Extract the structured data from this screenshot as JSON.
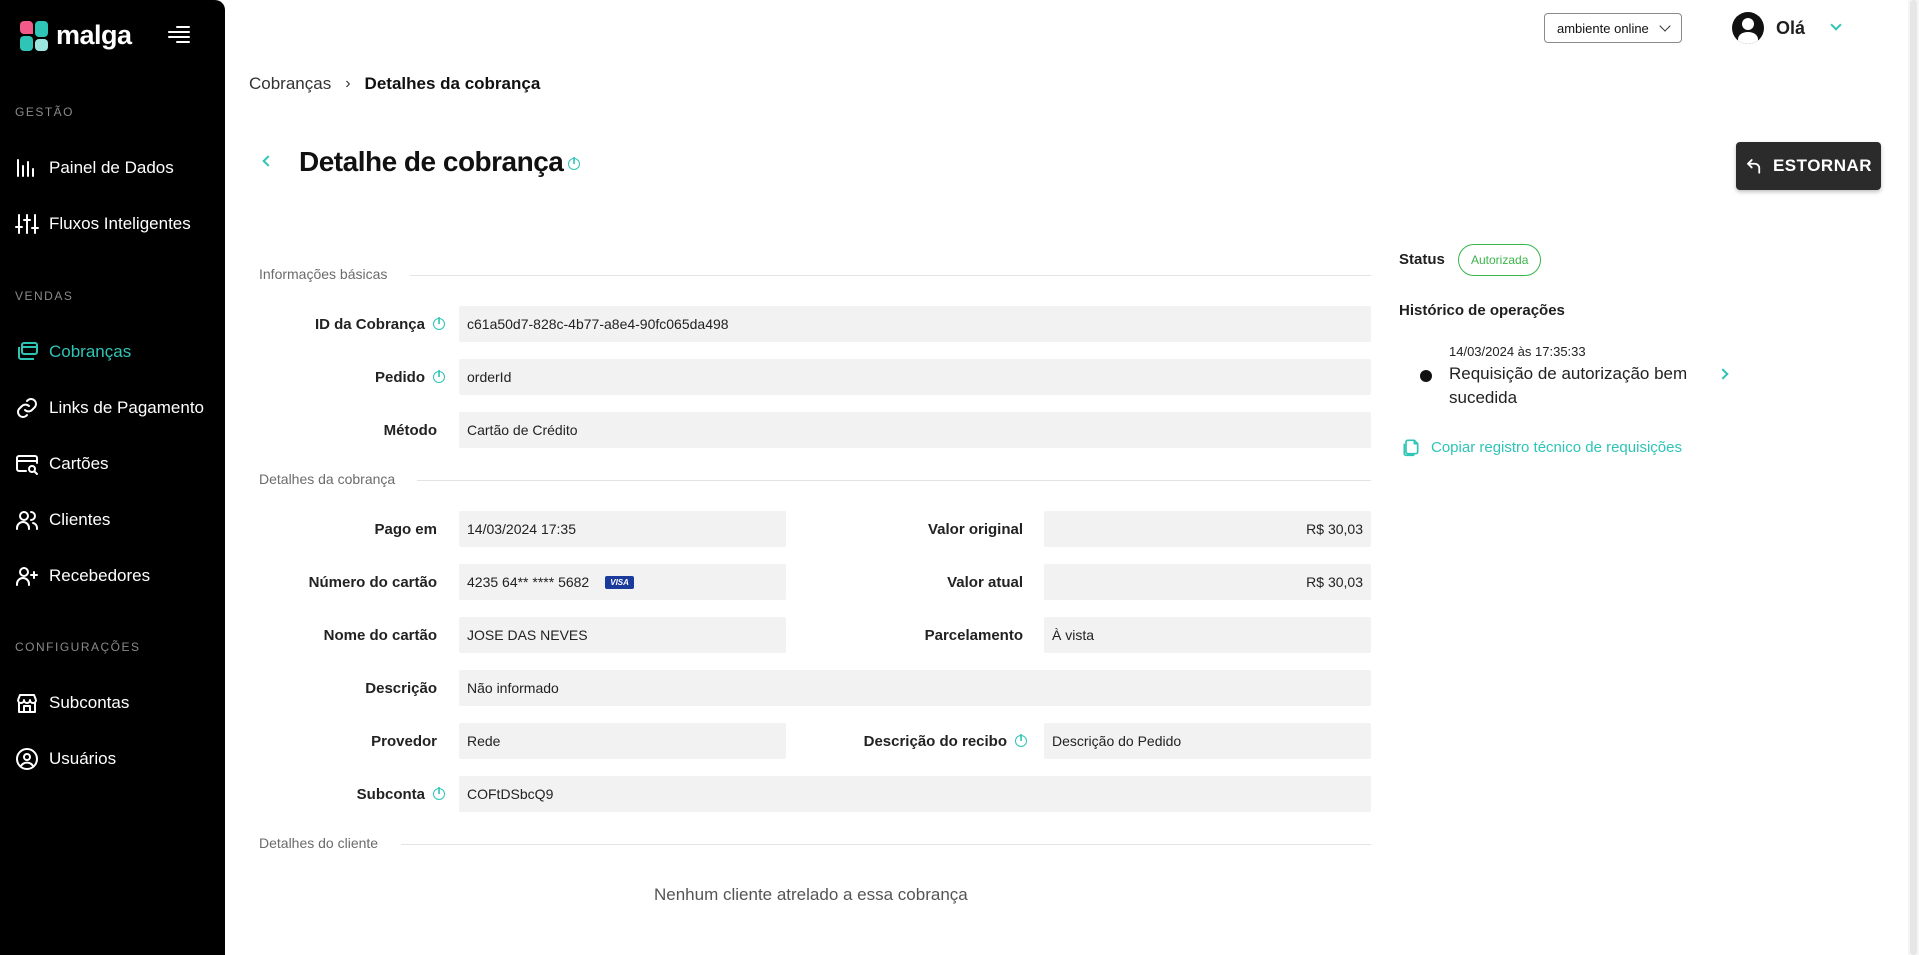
{
  "brand": {
    "name": "malga"
  },
  "sidebar": {
    "sections": [
      {
        "title": "GESTÃO",
        "items": [
          {
            "label": "Painel de Dados",
            "icon": "bar-chart-icon"
          },
          {
            "label": "Fluxos Inteligentes",
            "icon": "sliders-icon"
          }
        ]
      },
      {
        "title": "VENDAS",
        "items": [
          {
            "label": "Cobranças",
            "icon": "charges-icon",
            "active": true
          },
          {
            "label": "Links de Pagamento",
            "icon": "link-icon"
          },
          {
            "label": "Cartões",
            "icon": "card-search-icon"
          },
          {
            "label": "Clientes",
            "icon": "users-icon"
          },
          {
            "label": "Recebedores",
            "icon": "user-plus-icon"
          }
        ]
      },
      {
        "title": "CONFIGURAÇÕES",
        "items": [
          {
            "label": "Subcontas",
            "icon": "store-icon"
          },
          {
            "label": "Usuários",
            "icon": "user-circle-icon"
          }
        ]
      }
    ]
  },
  "topbar": {
    "environment": "ambiente online",
    "greeting": "Olá"
  },
  "breadcrumb": {
    "parent": "Cobranças",
    "current": "Detalhes da cobrança"
  },
  "header": {
    "title": "Detalhe de cobrança",
    "refund_label": "ESTORNAR"
  },
  "basic_info": {
    "title": "Informações básicas",
    "charge_id_label": "ID da Cobrança",
    "charge_id": "c61a50d7-828c-4b77-a8e4-90fc065da498",
    "order_label": "Pedido",
    "order": "orderId",
    "method_label": "Método",
    "method": "Cartão de Crédito"
  },
  "charge_details": {
    "title": "Detalhes da cobrança",
    "paid_at_label": "Pago em",
    "paid_at": "14/03/2024 17:35",
    "original_value_label": "Valor original",
    "original_value": "R$ 30,03",
    "card_number_label": "Número do cartão",
    "card_number": "4235 64** **** 5682",
    "card_brand": "VISA",
    "current_value_label": "Valor atual",
    "current_value": "R$ 30,03",
    "card_name_label": "Nome do cartão",
    "card_name": "JOSE DAS NEVES",
    "installments_label": "Parcelamento",
    "installments": "À vista",
    "description_label": "Descrição",
    "description": "Não informado",
    "provider_label": "Provedor",
    "provider": "Rede",
    "receipt_desc_label": "Descrição do recibo",
    "receipt_desc": "Descrição do Pedido",
    "subaccount_label": "Subconta",
    "subaccount": "COFtDSbcQ9"
  },
  "client_details": {
    "title": "Detalhes do cliente",
    "empty": "Nenhum cliente atrelado a essa cobrança"
  },
  "status_panel": {
    "status_label": "Status",
    "status": "Autorizada",
    "history_title": "Histórico de operações",
    "history": [
      {
        "date": "14/03/2024 às 17:35:33",
        "text": "Requisição de autorização bem sucedida"
      }
    ],
    "copy_log": "Copiar registro técnico de requisições"
  },
  "colors": {
    "accent": "#2ec4b6",
    "success": "#3bb54a",
    "sidebar_bg": "#000000"
  }
}
